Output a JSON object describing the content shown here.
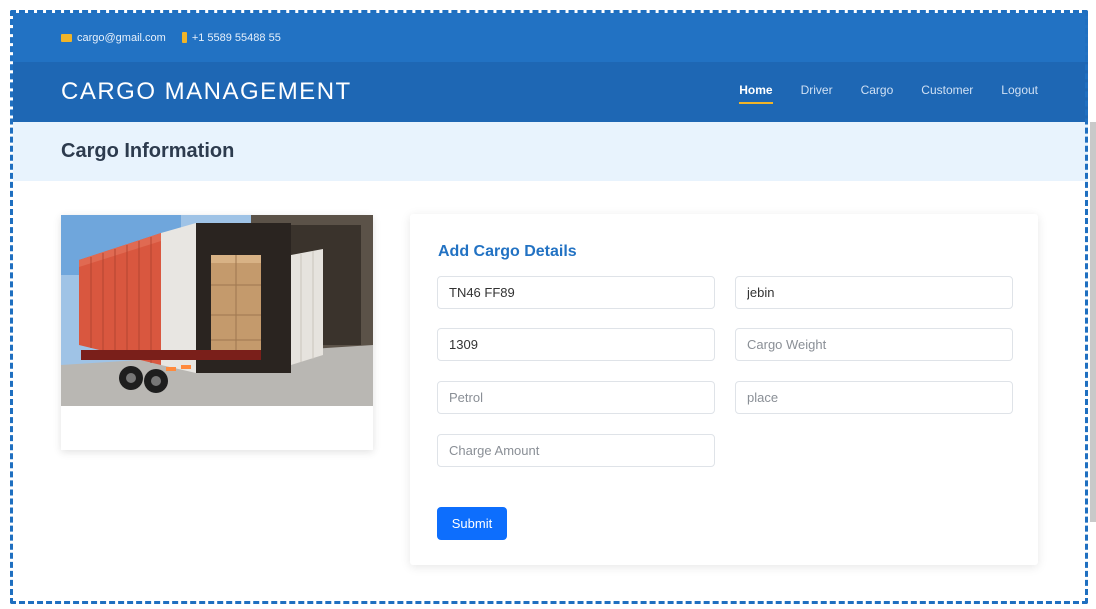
{
  "topbar": {
    "email": "cargo@gmail.com",
    "phone": "+1 5589 55488 55"
  },
  "navbar": {
    "brand": "CARGO MANAGEMENT",
    "links": [
      {
        "label": "Home",
        "active": true
      },
      {
        "label": "Driver"
      },
      {
        "label": "Cargo"
      },
      {
        "label": "Customer"
      },
      {
        "label": "Logout"
      }
    ]
  },
  "page": {
    "title": "Cargo Information"
  },
  "form": {
    "title": "Add Cargo Details",
    "fields": [
      {
        "value": "TN46 FF89",
        "placeholder": ""
      },
      {
        "value": "jebin",
        "placeholder": ""
      },
      {
        "value": "1309",
        "placeholder": ""
      },
      {
        "value": "",
        "placeholder": "Cargo Weight"
      },
      {
        "value": "",
        "placeholder": "Petrol"
      },
      {
        "value": "",
        "placeholder": "place"
      },
      {
        "value": "",
        "placeholder": "Charge Amount"
      }
    ],
    "submit_label": "Submit"
  },
  "colors": {
    "primary": "#2272c3",
    "accent": "#f0b429",
    "button": "#0d6efd"
  }
}
